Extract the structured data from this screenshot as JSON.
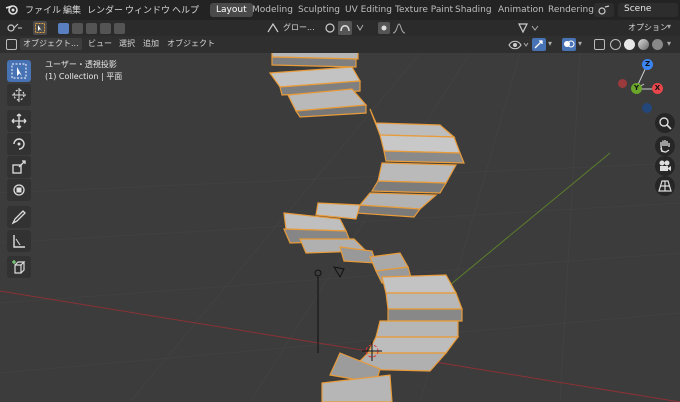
{
  "topbar": {
    "menus": [
      "ファイル",
      "編集",
      "レンダー",
      "ウィンドウ",
      "ヘルプ"
    ],
    "workspaces": [
      "Layout",
      "Modeling",
      "Sculpting",
      "UV Editing",
      "Texture Paint",
      "Shading",
      "Animation",
      "Rendering"
    ],
    "active_workspace": "Layout",
    "scene_name": "Scene"
  },
  "toolheader": {
    "transform_orientation": "グロー...",
    "options_label": "オプション"
  },
  "viewheader": {
    "mode": "オブジェクト...",
    "menus": [
      "ビュー",
      "選択",
      "追加",
      "オブジェクト"
    ]
  },
  "viewport": {
    "view_name": "ユーザー・透視投影",
    "collection_info": "(1) Collection | 平面"
  },
  "gizmo": {
    "axes": [
      "Z",
      "Y",
      "X"
    ],
    "colors": {
      "x": "#e7474b",
      "y": "#6aa72b",
      "z": "#3b85f3"
    }
  },
  "colors": {
    "accent": "#4772b3",
    "selection_outline": "#e89b3a",
    "grid_x_axis": "#8b3135",
    "grid_y_axis": "#5c7f2c"
  }
}
